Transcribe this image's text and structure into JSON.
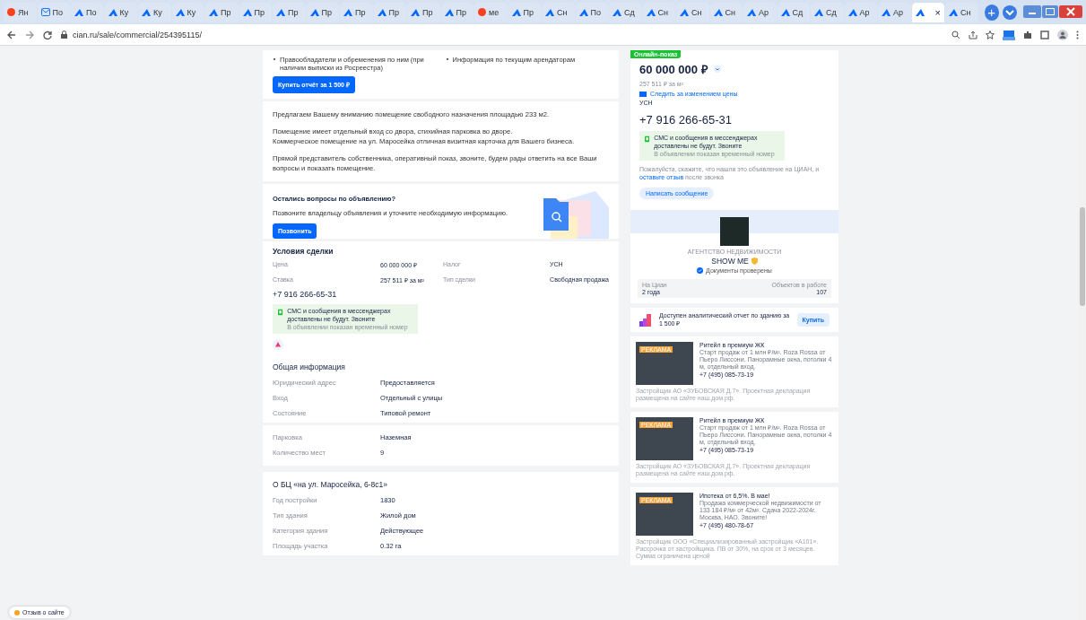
{
  "browser": {
    "tabs": [
      {
        "kind": "yandex",
        "label": "Ян",
        "selected": false
      },
      {
        "kind": "mail",
        "label": "По",
        "selected": false
      },
      {
        "kind": "peak",
        "label": "По",
        "selected": false
      },
      {
        "kind": "peak",
        "label": "Ку",
        "selected": false
      },
      {
        "kind": "peak",
        "label": "Ку",
        "selected": false
      },
      {
        "kind": "peak",
        "label": "Ку",
        "selected": false
      },
      {
        "kind": "peak",
        "label": "Пр",
        "selected": false
      },
      {
        "kind": "peak",
        "label": "Пр",
        "selected": false
      },
      {
        "kind": "peak",
        "label": "Пр",
        "selected": false
      },
      {
        "kind": "peak",
        "label": "Пр",
        "selected": false
      },
      {
        "kind": "peak",
        "label": "Пр",
        "selected": false
      },
      {
        "kind": "peak",
        "label": "Пр",
        "selected": false
      },
      {
        "kind": "peak",
        "label": "Пр",
        "selected": false
      },
      {
        "kind": "peak",
        "label": "Пр",
        "selected": false
      },
      {
        "kind": "yandex",
        "label": "ме",
        "selected": false
      },
      {
        "kind": "peak",
        "label": "Пр",
        "selected": false
      },
      {
        "kind": "peak",
        "label": "Сн",
        "selected": false
      },
      {
        "kind": "peak",
        "label": "По",
        "selected": false
      },
      {
        "kind": "peak",
        "label": "Сд",
        "selected": false
      },
      {
        "kind": "peak",
        "label": "Сн",
        "selected": false
      },
      {
        "kind": "peak",
        "label": "Сн",
        "selected": false
      },
      {
        "kind": "peak",
        "label": "Сн",
        "selected": false
      },
      {
        "kind": "peak",
        "label": "Ар",
        "selected": false
      },
      {
        "kind": "peak",
        "label": "Сд",
        "selected": false
      },
      {
        "kind": "peak",
        "label": "Сд",
        "selected": false
      },
      {
        "kind": "peak",
        "label": "Ар",
        "selected": false
      },
      {
        "kind": "peak",
        "label": "Ар",
        "selected": false
      },
      {
        "kind": "peak",
        "close": "×",
        "selected": true
      },
      {
        "kind": "peak",
        "label": "Сн",
        "selected": false
      }
    ],
    "new_tab": "+",
    "address": "cian.ru/sale/commercial/254395115/"
  },
  "report_offer": {
    "bullets": [
      "Правообладатели и обременения по ним (при наличии выписки из Росреестра)",
      "Информация по текущим арендаторам"
    ],
    "button": "Купить отчёт за 1 500 ₽"
  },
  "description": {
    "paragraphs": [
      "Предлагаем Вашему вниманию помещение свободного назначения площадью 233 м2.",
      "Помещение имеет отдельный вход со двора, стихийная парковка во дворе.\nКоммерческое помещение на ул. Маросейка отличная визитная карточка для Вашего бизнеса.",
      "Прямой представитель собственника, оперативный показ, звоните, будем рады ответить на все Ваши вопросы и показать помещение."
    ]
  },
  "questions": {
    "title": "Остались вопросы по объявлению?",
    "text": "Позвоните владельцу объявления и уточните необходимую информацию.",
    "button": "Позвонить"
  },
  "deal_terms": {
    "title": "Условия сделки",
    "items": [
      {
        "label": "Цена",
        "value": "60 000 000 ₽"
      },
      {
        "label": "Налог",
        "value": "УСН"
      },
      {
        "label": "Ставка",
        "value": "257 511 ₽ за м²"
      },
      {
        "label": "Тип сделки",
        "value": "Свободная продажа"
      }
    ],
    "phone": "+7 916 266-65-31",
    "notice": {
      "title": "СМС и сообщения в мессенджерах доставлены не будут. Звоните",
      "subtitle": "В объявлении показан временный номер"
    }
  },
  "general_info": {
    "title": "Общая информация",
    "items": [
      {
        "label": "Юридический адрес",
        "value": "Предоставляется"
      },
      {
        "label": "Вход",
        "value": "Отдельный с улицы"
      },
      {
        "label": "Состояние",
        "value": "Типовой ремонт"
      }
    ]
  },
  "parking": {
    "items": [
      {
        "label": "Парковка",
        "value": "Наземная"
      },
      {
        "label": "Количество мест",
        "value": "9"
      }
    ]
  },
  "building": {
    "title": "О БЦ «на ул. Маросейка, 6-8с1»",
    "items": [
      {
        "label": "Год постройки",
        "value": "1830"
      },
      {
        "label": "Тип здания",
        "value": "Жилой дом"
      },
      {
        "label": "Категория здания",
        "value": "Действующее"
      },
      {
        "label": "Площадь участка",
        "value": "0.32 га"
      }
    ]
  },
  "offer_card": {
    "badge": "Онлайн-показ",
    "price": "60 000 000 ₽",
    "price_per_m2": "257 511 ₽ за м²",
    "watch_link": "Следить за изменением цены",
    "tax": "УСН",
    "phone": "+7 916 266-65-31",
    "notice": {
      "title": "СМС и сообщения в мессенджерах доставлены не будут. Звоните",
      "subtitle": "В объявлении показан временный номер"
    },
    "hint": "Пожалуйста, скажите, что нашли это объявление на ЦИАН, и",
    "hint_link": "оставьте отзыв",
    "hint_end": "после звонка",
    "message_button": "Написать сообщение"
  },
  "agency": {
    "type": "АГЕНТСТВО НЕДВИЖИМОСТИ",
    "name": "SHOW ME",
    "verified": "Документы проверены",
    "stats": [
      {
        "label": "На Циан",
        "value": "2 года"
      },
      {
        "label": "Объектов в работе",
        "value": "107"
      }
    ]
  },
  "analytics": {
    "text": "Доступен аналитический отчет по зданию за 1 500 ₽",
    "button": "Купить"
  },
  "ads": [
    {
      "badge": "РЕКЛАМА",
      "title": "Ритейл в премиум ЖК",
      "text": "Старт продаж от 1 млн ₽/м². Roza Rossa от Пьеро Лиссони. Панорамные окна, потолки 4 м, отдельный вход.",
      "phone": "+7 (495) 085-73-19",
      "disclaimer": "Застройщик АО «ЗУБОВСКАЯ Д.7». Проектная декларация размещена на сайте наш.дом.рф."
    },
    {
      "badge": "РЕКЛАМА",
      "title": "Ритейл в премиум ЖК",
      "text": "Старт продаж от 1 млн ₽/м². Roza Rossa от Пьеро Лиссони. Панорамные окна, потолки 4 м, отдельный вход.",
      "phone": "+7 (495) 085-73-19",
      "disclaimer": "Застройщик АО «ЗУБОВСКАЯ Д.7». Проектная декларация размещена на сайте наш.дом.рф."
    },
    {
      "badge": "РЕКЛАМА",
      "title": "Ипотека от 6,5%. В мае!",
      "text": "Продажа коммерческой недвижимости от 133 184 ₽/м² от 42м². Сдача 2022-2024г. Москва, НАО. Звоните!",
      "phone": "+7 (495) 480-78-67",
      "disclaimer": "Застройщик ООО «Специализированный застройщик «А101». Рассрочка от застройщика. ПВ от 30%, на срок от 3 месяцев. Сумма ограничена ценой"
    }
  ],
  "feedback_button": "Отзыв о сайте"
}
